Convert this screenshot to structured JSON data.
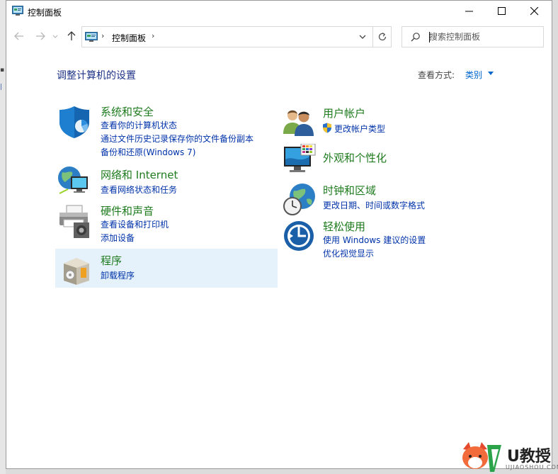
{
  "window": {
    "title": "控制面板"
  },
  "address": {
    "path": "控制面板"
  },
  "search": {
    "placeholder": "搜索控制面板"
  },
  "header": {
    "title": "调整计算机的设置",
    "view_by_label": "查看方式:",
    "view_by_value": "类别"
  },
  "categories": [
    {
      "title": "系统和安全",
      "links": [
        "查看你的计算机状态",
        "通过文件历史记录保存你的文件备份副本",
        "备份和还原(Windows 7)"
      ]
    },
    {
      "title": "网络和 Internet",
      "links": [
        "查看网络状态和任务"
      ]
    },
    {
      "title": "硬件和声音",
      "links": [
        "查看设备和打印机",
        "添加设备"
      ]
    },
    {
      "title": "程序",
      "links": [
        "卸载程序"
      ]
    },
    {
      "title": "用户帐户",
      "links": [
        "更改帐户类型"
      ]
    },
    {
      "title": "外观和个性化",
      "links": []
    },
    {
      "title": "时钟和区域",
      "links": [
        "更改日期、时间或数字格式"
      ]
    },
    {
      "title": "轻松使用",
      "links": [
        "使用 Windows 建议的设置",
        "优化视觉显示"
      ]
    }
  ],
  "watermark": {
    "text": "U教授",
    "sub": "UJIAOSHOU.COM"
  },
  "colors": {
    "link": "#0033aa",
    "category": "#1e7b1e",
    "heading": "#1e3287",
    "hover": "#e5f1fb"
  }
}
